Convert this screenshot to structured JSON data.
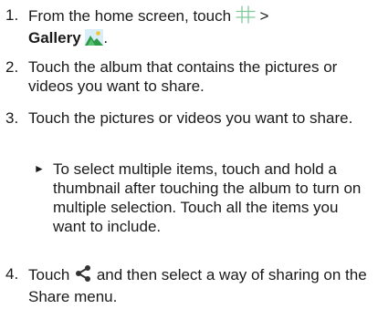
{
  "steps": [
    {
      "number": "1.",
      "text_before": "From the home screen, touch",
      "separator": ">",
      "bold_label": "Gallery",
      "after_bold": ".",
      "icons": [
        "apps-grid-icon",
        "gallery-icon"
      ]
    },
    {
      "number": "2.",
      "text": "Touch the album that contains the pictures or videos you want to share."
    },
    {
      "number": "3.",
      "text": "Touch the pictures or videos you want to share.",
      "sub": {
        "bullet": "►",
        "text": "To select multiple items, touch and hold a thumbnail after touching the album to turn on multiple selection. Touch all the items you want to include."
      }
    },
    {
      "number": "4.",
      "text_before": "Touch",
      "text_after": "and then select a way of sharing on the Share menu.",
      "icon": "share-icon"
    }
  ]
}
